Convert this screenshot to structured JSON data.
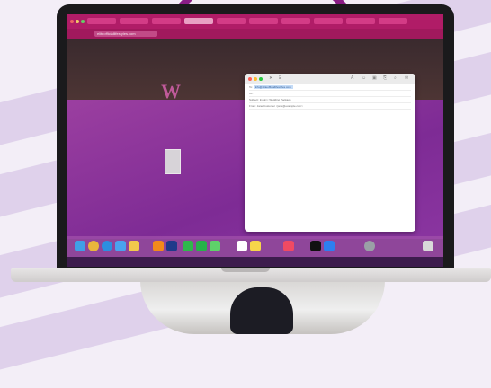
{
  "colors": {
    "ring": "#8a1d86",
    "browser_chrome": "#b01c67",
    "site_purple": "#8a35a0",
    "background": "#f3eef7"
  },
  "browser": {
    "tab_count": 10,
    "url": "eliteofficiallifestyles.com"
  },
  "site": {
    "logo_letter": "W"
  },
  "mail": {
    "window": "compose",
    "to": "info@eliteofficiallifestyles.com",
    "cc": "Cc:",
    "subject_label": "Subject:",
    "subject": "Inquiry: Wedding Package",
    "from_label": "From:",
    "from": "Jane Customer <jane@example.com>"
  },
  "dock": {
    "icon_names": [
      "finder-icon",
      "chrome-icon",
      "safari-icon",
      "mail-icon",
      "photos-icon",
      "illustrator-icon",
      "photoshop-icon",
      "messages-icon",
      "facetime-icon",
      "maps-icon",
      "calendar-icon",
      "notes-icon",
      "music-icon",
      "tv-icon",
      "app-store-icon",
      "settings-icon",
      "trash-icon"
    ]
  }
}
